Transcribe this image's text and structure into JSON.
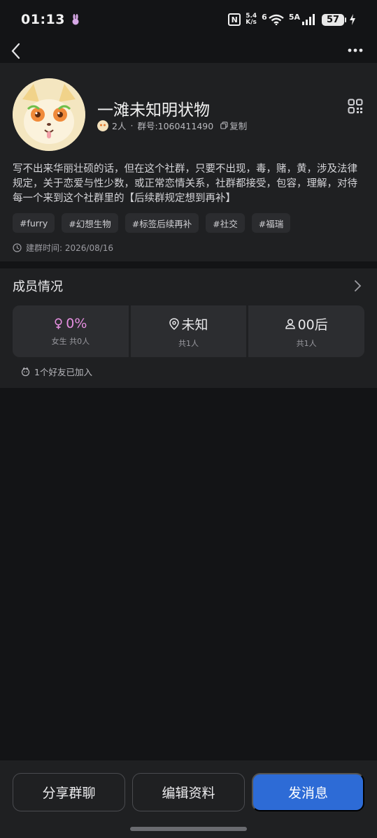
{
  "status_bar": {
    "time": "01:13",
    "net_speed_top": "5.4",
    "net_speed_bottom": "K/s",
    "wifi_label": "6",
    "signal_label": "5A",
    "battery": "57"
  },
  "group": {
    "name": "一滩未知明状物",
    "member_count": "2人",
    "group_id_label": "群号:1060411490",
    "copy_label": "复制",
    "description": "写不出来华丽壮硕的话，但在这个社群，只要不出现，毒，赌，黄，涉及法律规定，关于恋爱与性少数，或正常恋情关系，社群都接受，包容，理解，对待每一个来到这个社群里的【后续群规定想到再补】",
    "tags": [
      "#furry",
      "#幻想生物",
      "#标签后续再补",
      "#社交",
      "#福瑞"
    ],
    "created_label": "建群时间: 2026/08/16"
  },
  "members": {
    "title": "成员情况",
    "stats": [
      {
        "value": "0%",
        "sub": "女生 共0人"
      },
      {
        "value": "未知",
        "sub": "共1人"
      },
      {
        "value": "00后",
        "sub": "共1人"
      }
    ],
    "friends_label": "1个好友已加入"
  },
  "actions": {
    "share": "分享群聊",
    "edit": "编辑资料",
    "message": "发消息"
  },
  "colors": {
    "primary": "#2d6bd6",
    "female": "#e58fe0"
  }
}
